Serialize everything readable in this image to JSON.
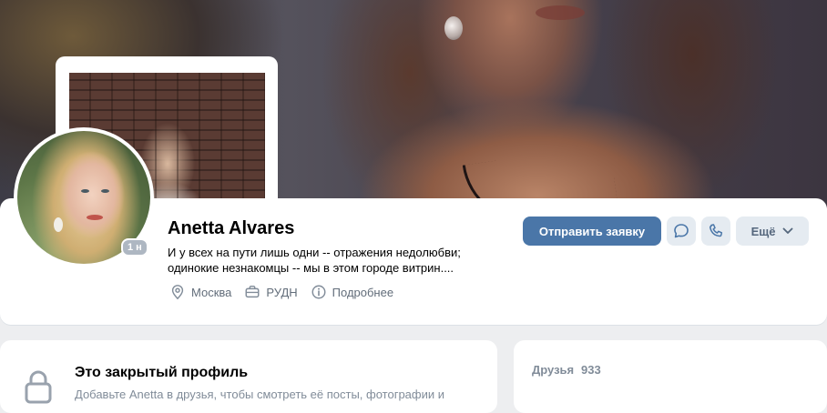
{
  "profile": {
    "name": "Anetta Alvares",
    "online_badge": "1 н",
    "status_line1": "И у всех на пути лишь одни -- отражения недолюбви;",
    "status_line2": "одинокие незнакомцы -- мы в этом городе витрин....",
    "city": "Москва",
    "education": "РУДН",
    "more_info": "Подробнее"
  },
  "actions": {
    "send_request": "Отправить заявку",
    "more_label": "Ещё"
  },
  "closed_profile": {
    "title": "Это закрытый профиль",
    "subtitle": "Добавьте Anetta в друзья, чтобы смотреть её посты, фотографии и"
  },
  "friends": {
    "label": "Друзья",
    "count": "933"
  },
  "colors": {
    "accent": "#4a76a8",
    "secondary_button": "#e5ebf1",
    "muted_text": "#818c99"
  },
  "icons": [
    "location-pin-icon",
    "briefcase-icon",
    "info-icon",
    "message-icon",
    "phone-icon",
    "chevron-down-icon",
    "lock-icon"
  ]
}
